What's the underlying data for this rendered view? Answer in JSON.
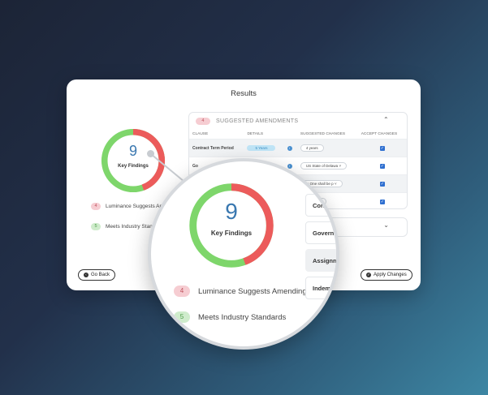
{
  "title": "Results",
  "findings": {
    "total": "9",
    "label": "Key Findings",
    "amend_count": 4,
    "standard_count": 5,
    "amend_color": "#ec5b5b",
    "standard_color": "#7ed66b"
  },
  "legend": {
    "amend": {
      "count": "4",
      "label": "Luminance Suggests Amending",
      "small_label": "Luminance Suggests Amen"
    },
    "standard": {
      "count": "5",
      "label": "Meets Industry Standards",
      "small_label": "Meets Industry Stan"
    }
  },
  "amendments": {
    "count": "4",
    "header": "SUGGESTED AMENDMENTS",
    "columns": [
      "CLAUSE",
      "DETAILS",
      "SUGGESTED CHANGES",
      "ACCEPT CHANGES"
    ],
    "rows": [
      {
        "clause": "Contract Term Period",
        "details": "5 Years",
        "change": "4 years"
      },
      {
        "clause": "Go",
        "details": "",
        "change": "US State of Delawa"
      },
      {
        "clause": "",
        "details": "",
        "change": "ty One shall be p"
      },
      {
        "clause": "",
        "details": "",
        "change": "bility ur"
      }
    ]
  },
  "lens_rows": [
    "Contr",
    "Governi",
    "Assignme",
    "Indemn"
  ],
  "buttons": {
    "back": "Go Back",
    "apply": "Apply Changes"
  }
}
